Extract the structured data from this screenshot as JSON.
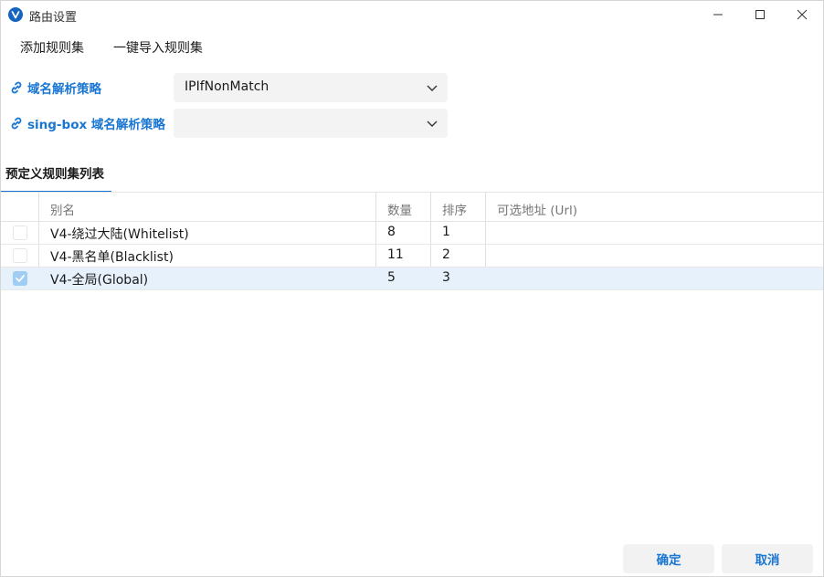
{
  "window": {
    "title": "路由设置"
  },
  "menu": {
    "add_ruleset": "添加规则集",
    "import_ruleset": "一键导入规则集"
  },
  "settings": {
    "domain_strategy": {
      "label": "域名解析策略",
      "value": "IPIfNonMatch"
    },
    "singbox_domain_strategy": {
      "label": "sing-box 域名解析策略",
      "value": ""
    }
  },
  "tab": {
    "label": "预定义规则集列表"
  },
  "table": {
    "headers": {
      "name": "别名",
      "count": "数量",
      "sort": "排序",
      "url": "可选地址 (Url)"
    },
    "rows": [
      {
        "name": "V4-绕过大陆(Whitelist)",
        "count": "8",
        "sort": "1",
        "url": "",
        "checked": false
      },
      {
        "name": "V4-黑名单(Blacklist)",
        "count": "11",
        "sort": "2",
        "url": "",
        "checked": false
      },
      {
        "name": "V4-全局(Global)",
        "count": "5",
        "sort": "3",
        "url": "",
        "checked": true
      }
    ]
  },
  "buttons": {
    "ok": "确定",
    "cancel": "取消"
  },
  "colors": {
    "accent": "#1976d2",
    "selected_row": "#e6f1fb",
    "app_icon": "#1565c0"
  }
}
